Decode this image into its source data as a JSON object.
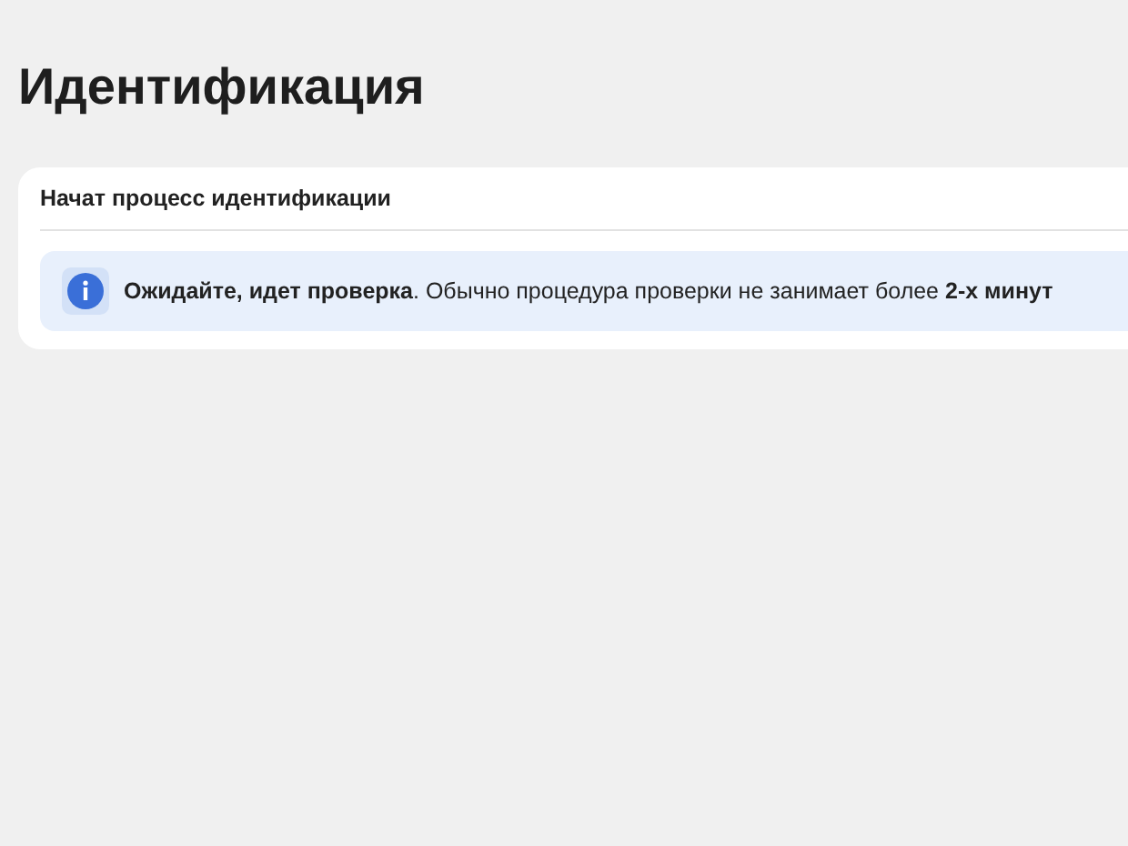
{
  "page": {
    "title": "Идентификация"
  },
  "card": {
    "title": "Начат процесс идентификации",
    "notice": {
      "kind": "info",
      "text": "**Ожидайте, идет проверка**. Обычно процедура проверки не занимает более **2-х минут**"
    }
  }
}
